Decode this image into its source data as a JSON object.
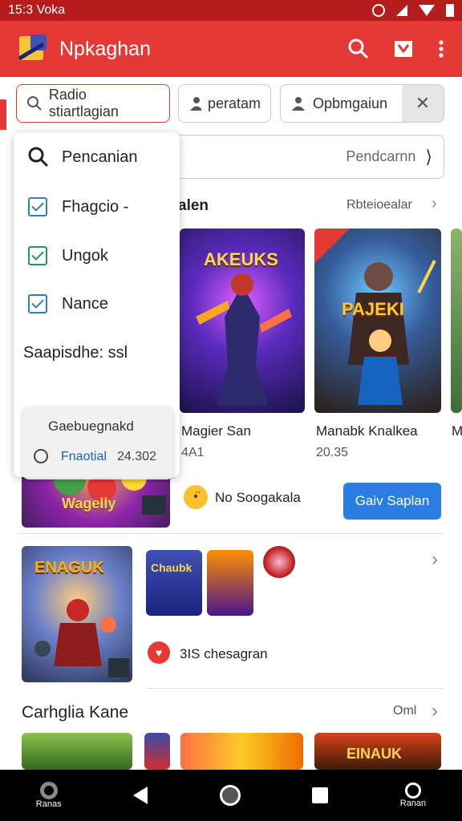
{
  "status": {
    "time": "15:3 Voka"
  },
  "app": {
    "title": "Npkaghan"
  },
  "chips": [
    "Radio stiartlagian",
    "peratam",
    "Opbmgaiun"
  ],
  "search_bar": {
    "text": "Pendcarnn"
  },
  "dropdown": {
    "search_label": "Pencanian",
    "options": [
      "Fhagcio -",
      "Ungok",
      "Nance"
    ],
    "section": "Saapisdhe: ssl"
  },
  "tooltip": {
    "title": "Gaebuegnakd",
    "link": "Fnaotial",
    "value": "24.302"
  },
  "section1": {
    "title": "alen",
    "more": "Rbteioealar"
  },
  "games": [
    {
      "name": "Magier San",
      "sub": "4A1",
      "art": "AKEUKS"
    },
    {
      "name": "Manabk Knalkea",
      "sub": "20.35",
      "art": "PAJEKI"
    }
  ],
  "banner_art": "Wagelly",
  "edge_letter": "M",
  "promo": {
    "text": "No Soogakala",
    "button": "Gaiv Saplan"
  },
  "row2": {
    "big_art": "ENAGUK",
    "small_art": "Chaubk",
    "info": "3IS chesagran"
  },
  "section2": {
    "title": "Carhglia Kane",
    "more": "Oml",
    "art": "EINAUK"
  },
  "navbar": {
    "left": "Ranas",
    "right": "Ranan"
  }
}
